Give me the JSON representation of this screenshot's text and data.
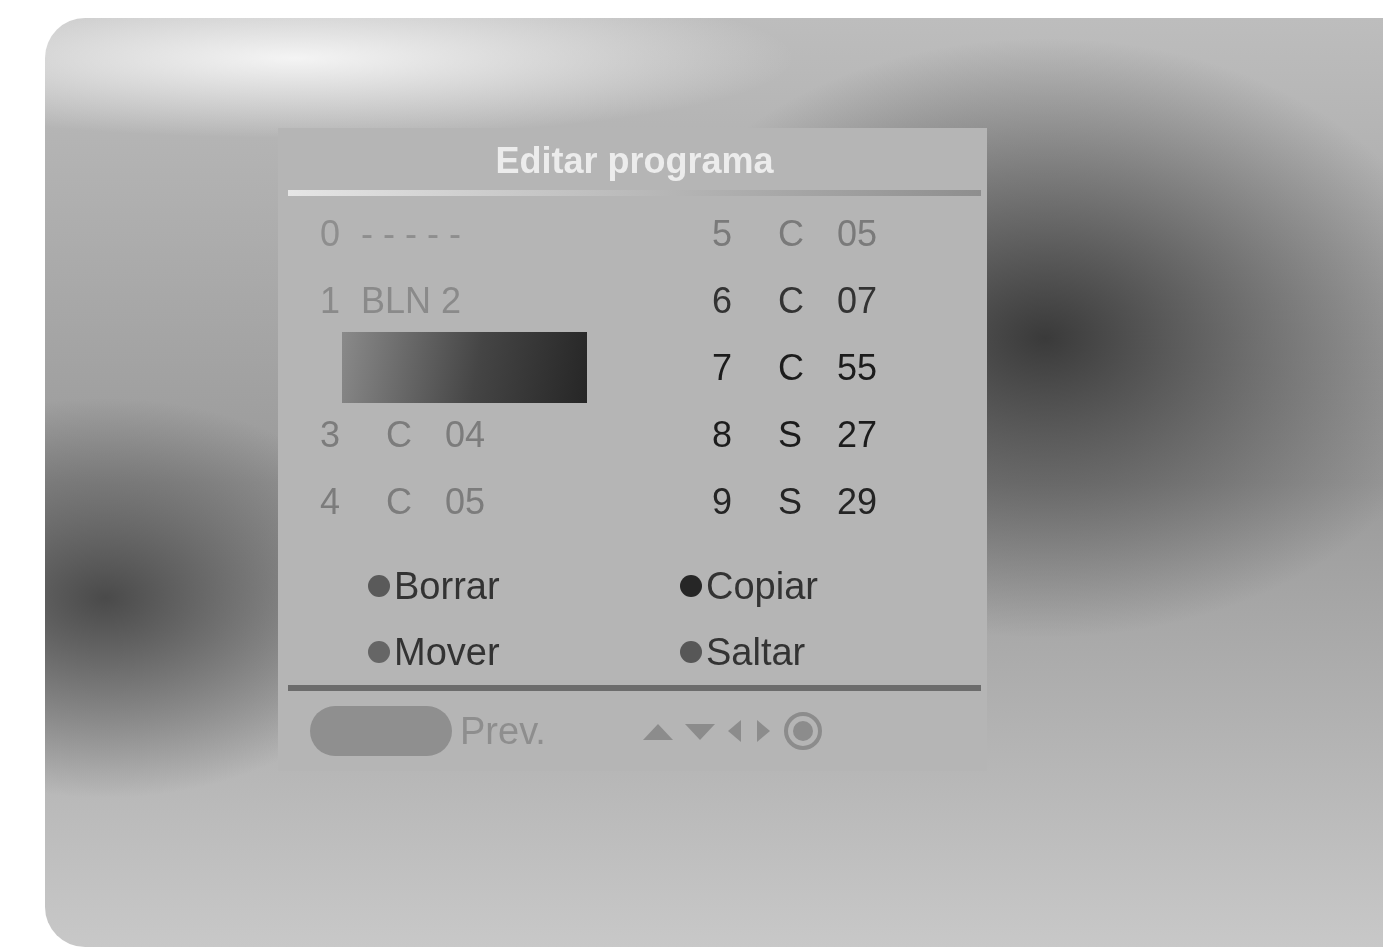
{
  "title": "Editar programa",
  "channels": [
    {
      "number": "0",
      "parts": [
        "- - - - -"
      ],
      "color": "#8e8e8e",
      "selected": false
    },
    {
      "number": "1",
      "parts": [
        "BLN 2"
      ],
      "color": "#8a8a8a",
      "selected": false
    },
    {
      "selected": true
    },
    {
      "number": "3",
      "parts": [
        "C",
        "04"
      ],
      "color": "#7c7c7c",
      "selected": false
    },
    {
      "number": "4",
      "parts": [
        "C",
        "05"
      ],
      "color": "#7c7c7c",
      "selected": false
    },
    {
      "number": "5",
      "parts": [
        "C",
        "05"
      ],
      "color": "#7a7a7a",
      "selected": false
    },
    {
      "number": "6",
      "parts": [
        "C",
        "07"
      ],
      "color": "#333333",
      "selected": false
    },
    {
      "number": "7",
      "parts": [
        "C",
        "55"
      ],
      "color": "#1c1c1c",
      "selected": false
    },
    {
      "number": "8",
      "parts": [
        "S",
        "27"
      ],
      "color": "#1c1c1c",
      "selected": false
    },
    {
      "number": "9",
      "parts": [
        "S",
        "29"
      ],
      "color": "#242424",
      "selected": false
    }
  ],
  "functions": [
    {
      "label": "Borrar",
      "color": "#5a5a5a"
    },
    {
      "label": "Copiar",
      "color": "#262626"
    },
    {
      "label": "Mover",
      "color": "#666666"
    },
    {
      "label": "Saltar",
      "color": "#575757"
    }
  ],
  "footer": {
    "label": "Prev."
  }
}
